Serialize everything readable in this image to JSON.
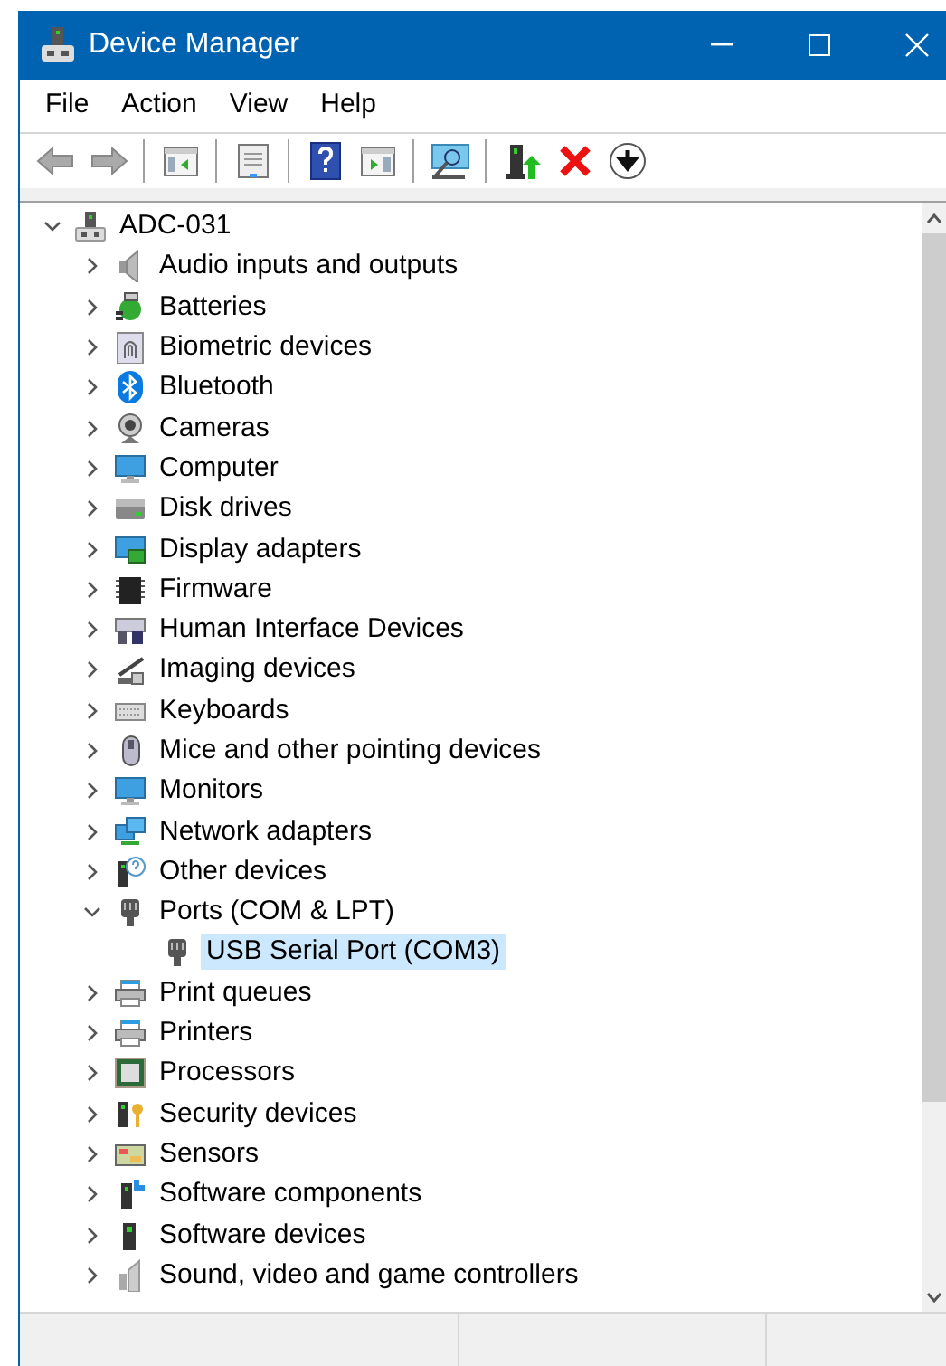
{
  "window": {
    "title": "Device Manager"
  },
  "menu": [
    "File",
    "Action",
    "View",
    "Help"
  ],
  "tree": {
    "label": "ADC-031",
    "expanded": true,
    "selected": false,
    "children": [
      {
        "label": "Audio inputs and outputs",
        "expanded": false,
        "selected": false
      },
      {
        "label": "Batteries",
        "expanded": false,
        "selected": false
      },
      {
        "label": "Biometric devices",
        "expanded": false,
        "selected": false
      },
      {
        "label": "Bluetooth",
        "expanded": false,
        "selected": false
      },
      {
        "label": "Cameras",
        "expanded": false,
        "selected": false
      },
      {
        "label": "Computer",
        "expanded": false,
        "selected": false
      },
      {
        "label": "Disk drives",
        "expanded": false,
        "selected": false
      },
      {
        "label": "Display adapters",
        "expanded": false,
        "selected": false
      },
      {
        "label": "Firmware",
        "expanded": false,
        "selected": false
      },
      {
        "label": "Human Interface Devices",
        "expanded": false,
        "selected": false
      },
      {
        "label": "Imaging devices",
        "expanded": false,
        "selected": false
      },
      {
        "label": "Keyboards",
        "expanded": false,
        "selected": false
      },
      {
        "label": "Mice and other pointing devices",
        "expanded": false,
        "selected": false
      },
      {
        "label": "Monitors",
        "expanded": false,
        "selected": false
      },
      {
        "label": "Network adapters",
        "expanded": false,
        "selected": false
      },
      {
        "label": "Other devices",
        "expanded": false,
        "selected": false
      },
      {
        "label": "Ports (COM & LPT)",
        "expanded": true,
        "selected": false,
        "children": [
          {
            "label": "USB Serial Port (COM3)",
            "selected": true
          }
        ]
      },
      {
        "label": "Print queues",
        "expanded": false,
        "selected": false
      },
      {
        "label": "Printers",
        "expanded": false,
        "selected": false
      },
      {
        "label": "Processors",
        "expanded": false,
        "selected": false
      },
      {
        "label": "Security devices",
        "expanded": false,
        "selected": false
      },
      {
        "label": "Sensors",
        "expanded": false,
        "selected": false
      },
      {
        "label": "Software components",
        "expanded": false,
        "selected": false
      },
      {
        "label": "Software devices",
        "expanded": false,
        "selected": false
      },
      {
        "label": "Sound, video and game controllers",
        "expanded": false,
        "selected": false
      }
    ]
  }
}
